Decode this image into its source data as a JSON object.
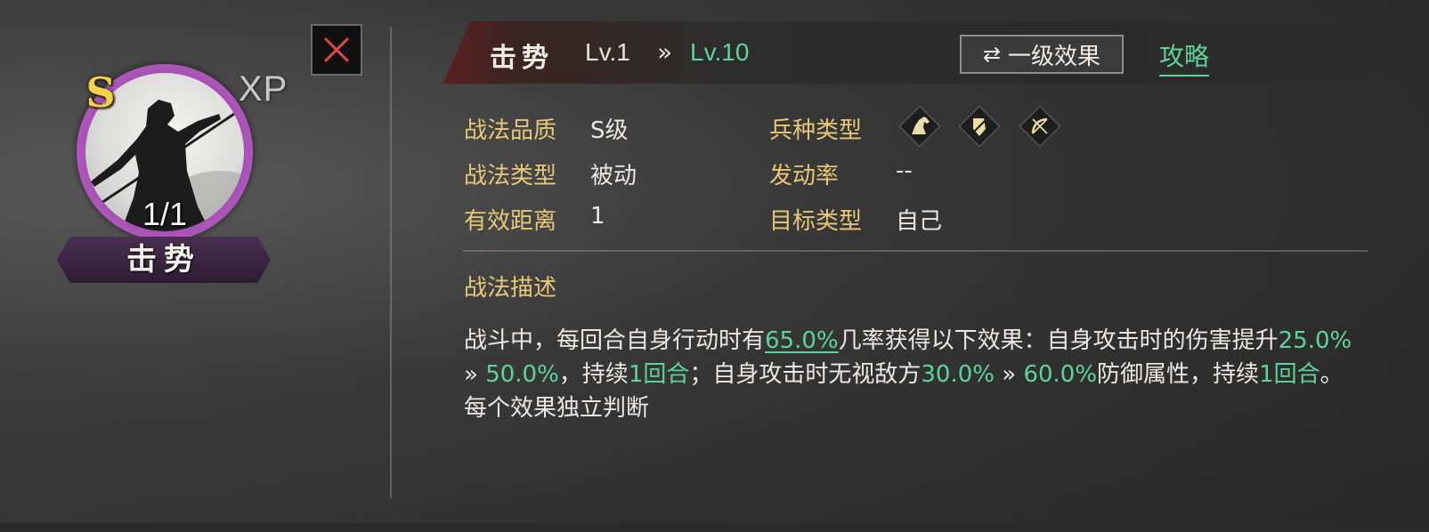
{
  "card": {
    "grade_badge": "S",
    "xp_label": "XP",
    "count": "1/1",
    "name": "击势"
  },
  "header": {
    "skill_name": "击势",
    "level_from": "Lv.1",
    "level_arrow": "»",
    "level_to": "Lv.10",
    "effect_toggle_icon": "⇄",
    "effect_toggle_label": "一级效果",
    "guide_link": "攻略"
  },
  "attributes": {
    "quality_label": "战法品质",
    "quality_value": "S级",
    "type_label": "战法类型",
    "type_value": "被动",
    "range_label": "有效距离",
    "range_value": "1",
    "troop_label": "兵种类型",
    "troop_icons": [
      "cavalry-icon",
      "shield-icon",
      "bow-icon"
    ],
    "rate_label": "发动率",
    "rate_value": "--",
    "target_label": "目标类型",
    "target_value": "自己"
  },
  "description": {
    "title": "战法描述",
    "seg1": "战斗中，每回合自身行动时有",
    "chance": "65.0%",
    "seg2": "几率获得以下效果：自身攻击时的伤害提升",
    "dmg_from": "25.0%",
    "arrow1": "»",
    "dmg_to": "50.0%",
    "seg3": "，持续",
    "dur1": "1回合",
    "seg4": "；自身攻击时无视敌方",
    "ign_from": "30.0%",
    "arrow2": "»",
    "ign_to": "60.0%",
    "seg5": "防御属性，持续",
    "dur2": "1回合",
    "seg6": "。每个效果独立判断"
  },
  "colors": {
    "accent_green": "#5fd49a",
    "label_gold": "#e8c878",
    "ring_purple": "#a54cb3",
    "close_red": "#e04848"
  }
}
